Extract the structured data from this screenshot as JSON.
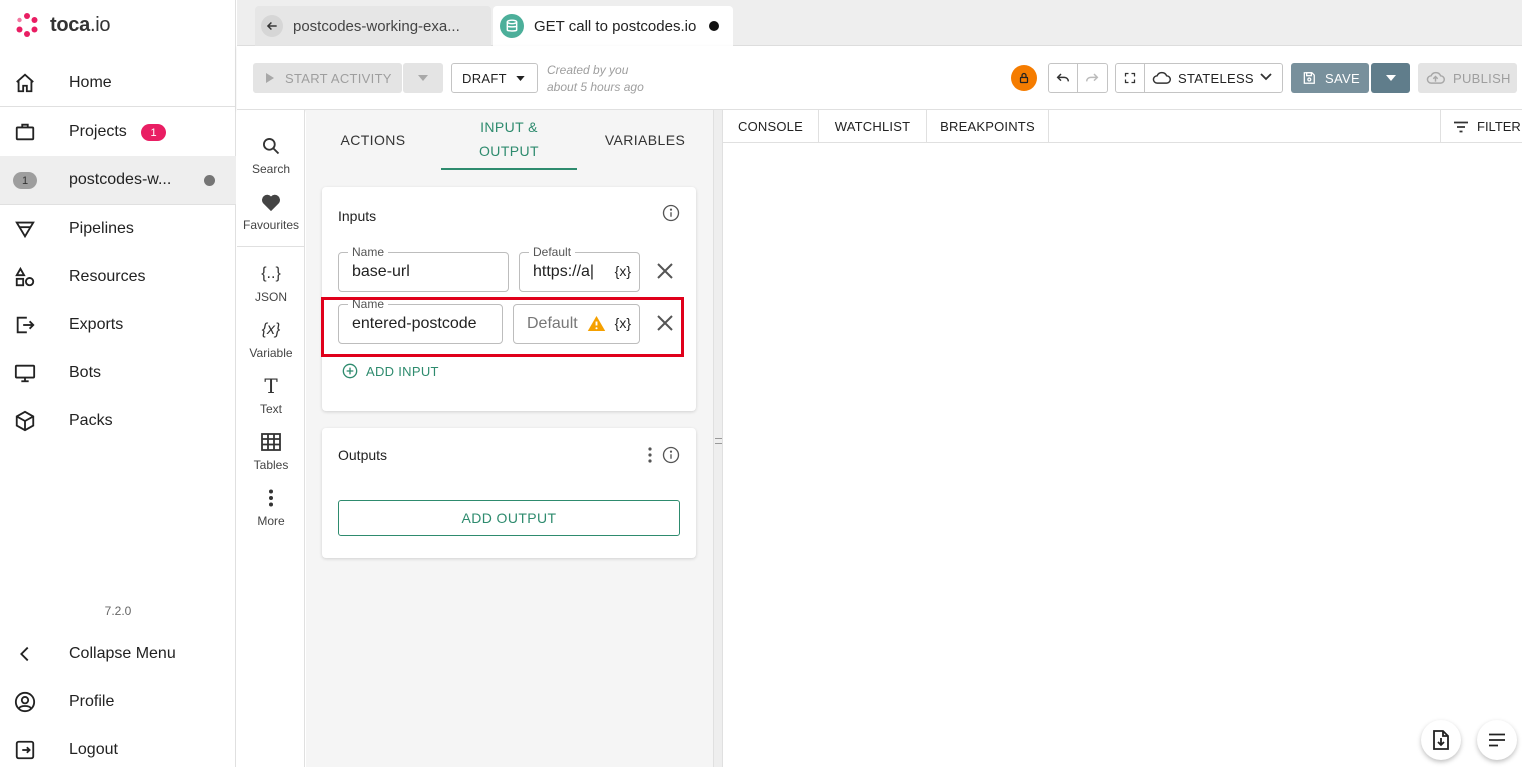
{
  "app": {
    "brand_bold": "toca",
    "brand_rest": ".io",
    "version": "7.2.0"
  },
  "nav": {
    "home": "Home",
    "projects": "Projects",
    "projects_badge": "1",
    "current_badge": "1",
    "current": "postcodes-w...",
    "pipelines": "Pipelines",
    "resources": "Resources",
    "exports": "Exports",
    "bots": "Bots",
    "packs": "Packs",
    "collapse": "Collapse Menu",
    "profile": "Profile",
    "logout": "Logout"
  },
  "tabs": {
    "inactive": "postcodes-working-exa...",
    "active": "GET call to postcodes.io"
  },
  "toolbar": {
    "start_activity": "START ACTIVITY",
    "draft": "DRAFT",
    "created_by": "Created by you",
    "created_when": "about 5 hours ago",
    "stateless": "STATELESS",
    "save": "SAVE",
    "publish": "PUBLISH"
  },
  "rail": {
    "search": "Search",
    "favourites": "Favourites",
    "json": "JSON",
    "json_glyph": "{..}",
    "variable": "Variable",
    "variable_glyph": "{x}",
    "text": "Text",
    "text_glyph": "T",
    "tables": "Tables",
    "more": "More"
  },
  "panel": {
    "tab_actions": "ACTIONS",
    "tab_io_1": "INPUT &",
    "tab_io_2": "OUTPUT",
    "tab_variables": "VARIABLES",
    "inputs_title": "Inputs",
    "inputs": [
      {
        "name_label": "Name",
        "name_value": "base-url",
        "default_label": "Default",
        "default_value": "https://a|",
        "fx": "{x}"
      },
      {
        "name_label": "Name",
        "name_value": "entered-postcode",
        "default_placeholder": "Default",
        "fx": "{x}"
      }
    ],
    "add_input": "ADD INPUT",
    "outputs_title": "Outputs",
    "add_output": "ADD OUTPUT"
  },
  "console": {
    "tab_console": "CONSOLE",
    "tab_watchlist": "WATCHLIST",
    "tab_breakpoints": "BREAKPOINTS",
    "filter": "FILTER"
  },
  "colors": {
    "accent": "#2e8b6e",
    "badge": "#e91e63",
    "lock": "#f57c00",
    "warning": "#f5a000",
    "highlight": "#e0001b"
  }
}
